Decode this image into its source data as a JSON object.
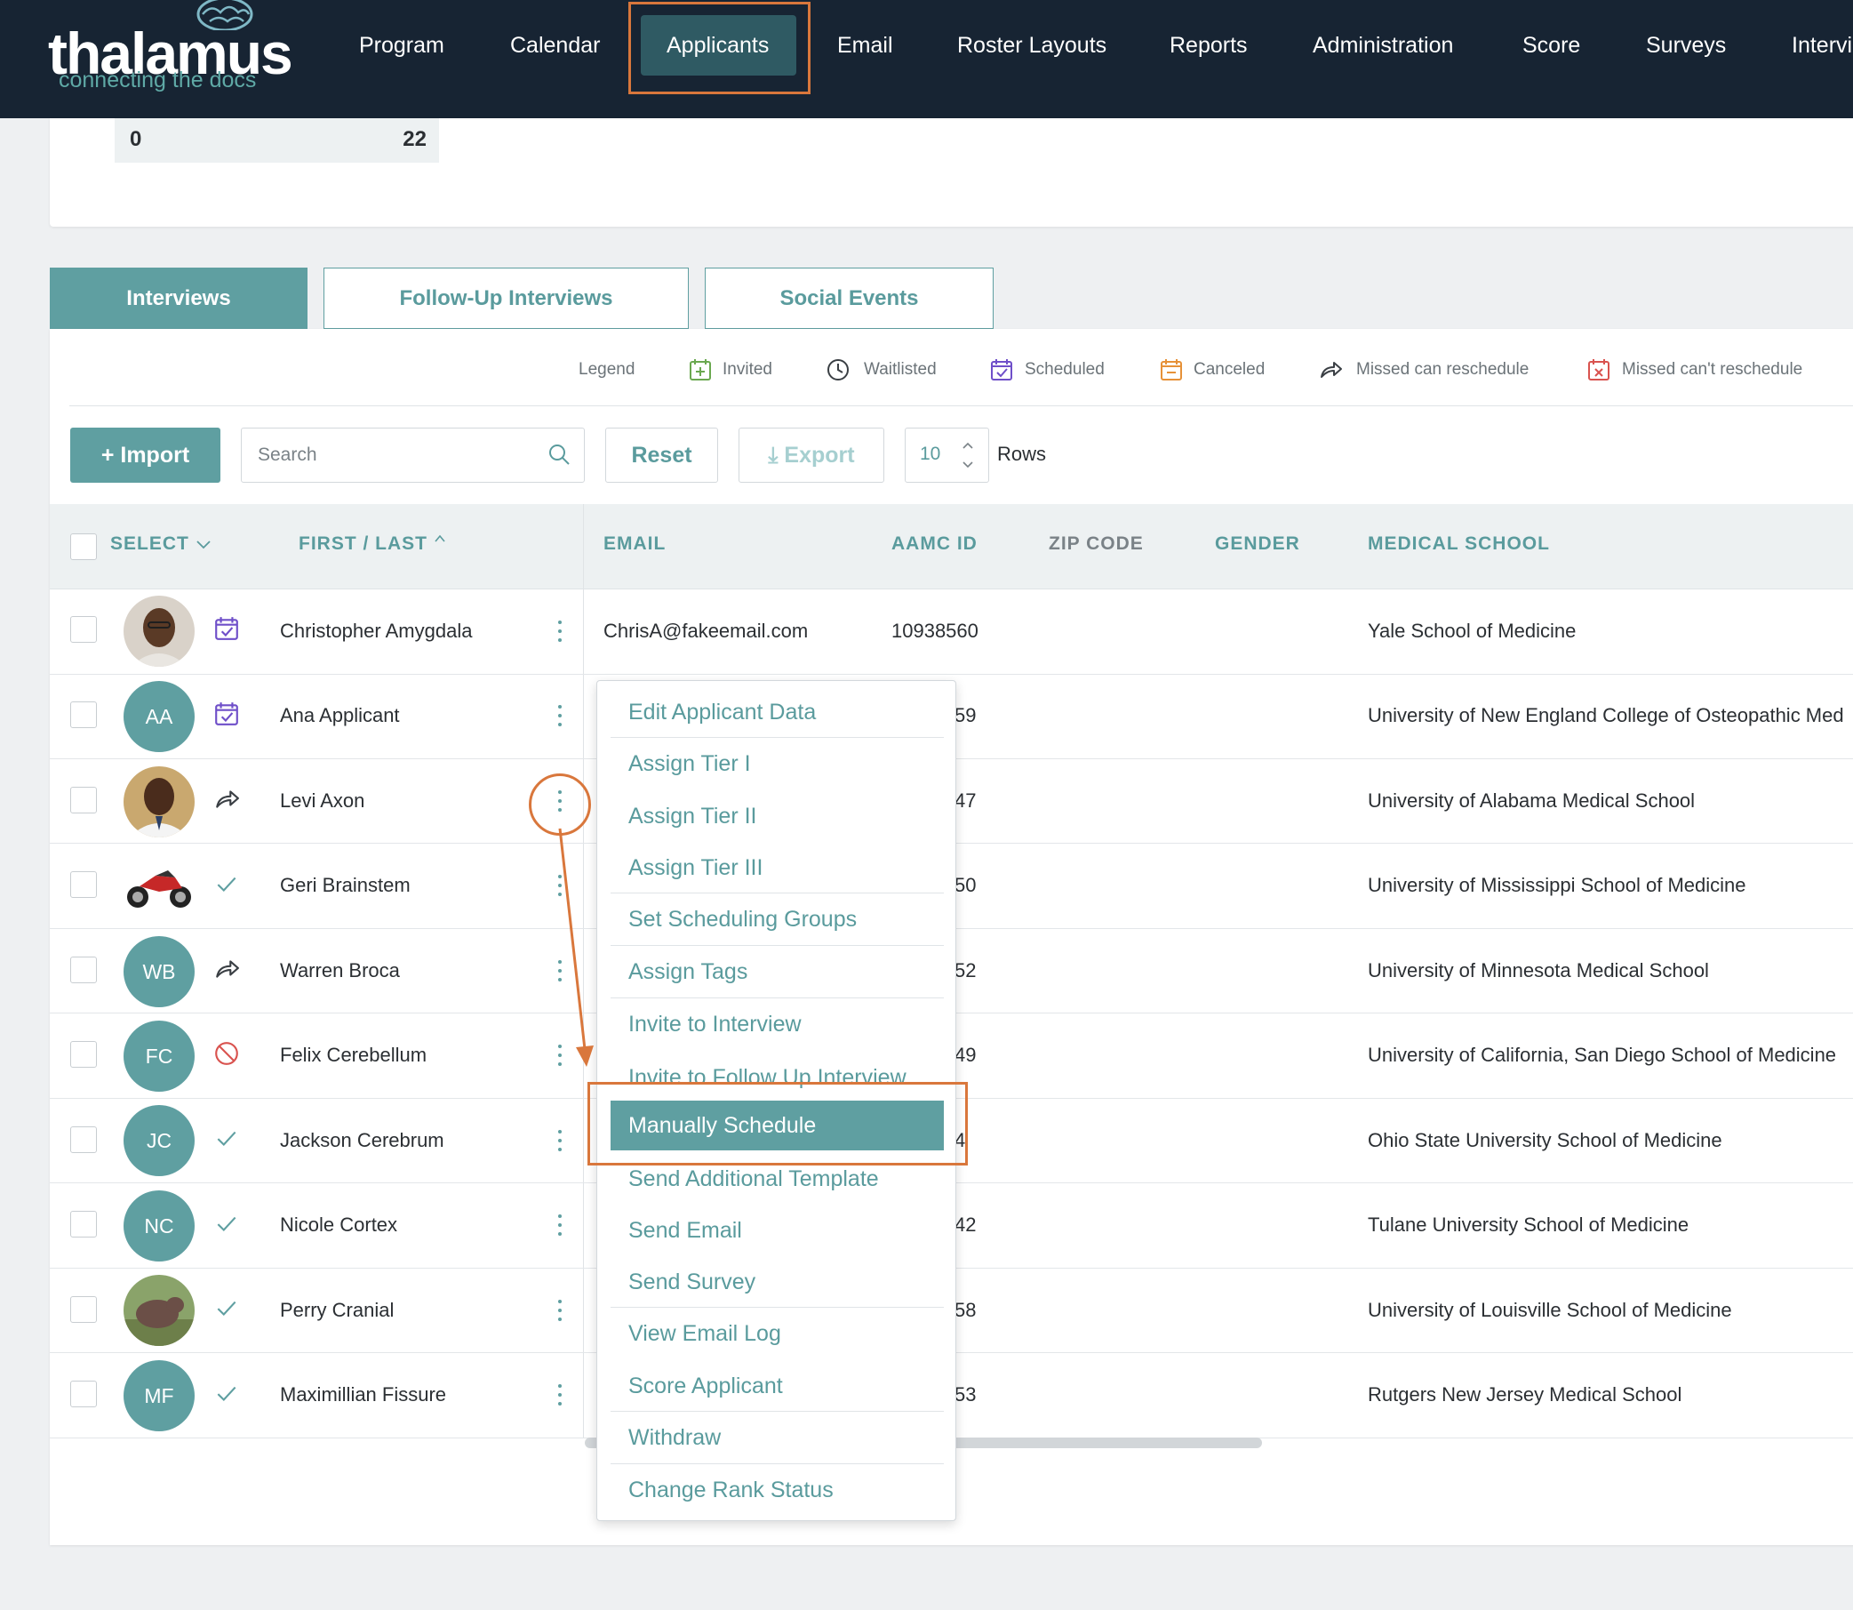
{
  "nav": {
    "logo_word": "thalamus",
    "logo_tagline": "connecting the docs",
    "items": [
      {
        "label": "Program"
      },
      {
        "label": "Calendar"
      },
      {
        "label": "Applicants",
        "active": true
      },
      {
        "label": "Email"
      },
      {
        "label": "Roster Layouts"
      },
      {
        "label": "Reports"
      },
      {
        "label": "Administration"
      },
      {
        "label": "Score"
      },
      {
        "label": "Surveys"
      },
      {
        "label": "Intervi"
      }
    ]
  },
  "summary": {
    "left_value": "0",
    "right_value": "22"
  },
  "tabs": [
    {
      "label": "Interviews",
      "active": true
    },
    {
      "label": "Follow-Up Interviews"
    },
    {
      "label": "Social Events"
    }
  ],
  "legend": {
    "title": "Legend",
    "items": [
      {
        "label": "Invited",
        "icon": "calendar-plus-icon",
        "color": "#6aa84f"
      },
      {
        "label": "Waitlisted",
        "icon": "clock-icon",
        "color": "#3a3f44"
      },
      {
        "label": "Scheduled",
        "icon": "calendar-check-icon",
        "color": "#6f4fc9"
      },
      {
        "label": "Canceled",
        "icon": "calendar-minus-icon",
        "color": "#e69138"
      },
      {
        "label": "Missed can reschedule",
        "icon": "share-arrow-icon",
        "color": "#3a3f44"
      },
      {
        "label": "Missed can't reschedule",
        "icon": "calendar-x-icon",
        "color": "#d9534f"
      }
    ]
  },
  "toolbar": {
    "import_label": "+ Import",
    "search_placeholder": "Search",
    "reset_label": "Reset",
    "export_label": "⤓ Export",
    "rows_value": "10",
    "rows_label": "Rows"
  },
  "table": {
    "headers": {
      "select": "SELECT",
      "name": "FIRST / LAST",
      "email": "EMAIL",
      "aamc": "AAMC ID",
      "zip": "ZIP CODE",
      "gender": "GENDER",
      "school": "MEDICAL SCHOOL"
    },
    "rows": [
      {
        "name": "Christopher Amygdala",
        "avatar": "photo",
        "status": "scheduled",
        "email": "ChrisA@fakeemail.com",
        "aamc": "10938560",
        "school": "Yale School of Medicine"
      },
      {
        "name": "Ana Applicant",
        "avatar": "AA",
        "status": "scheduled",
        "email": "",
        "aamc": "59",
        "school": "University of New England College of Osteopathic Med"
      },
      {
        "name": "Levi Axon",
        "avatar": "photo",
        "status": "missed-reschedule",
        "email": "",
        "aamc": "47",
        "school": "University of Alabama Medical School"
      },
      {
        "name": "Geri Brainstem",
        "avatar": "photo",
        "status": "check",
        "email": "",
        "aamc": "50",
        "school": "University of Mississippi School of Medicine"
      },
      {
        "name": "Warren Broca",
        "avatar": "WB",
        "status": "missed-reschedule",
        "email": "",
        "aamc": "52",
        "school": "University of Minnesota Medical School"
      },
      {
        "name": "Felix Cerebellum",
        "avatar": "FC",
        "status": "blocked",
        "email": "",
        "aamc": "49",
        "school": "University of California, San Diego School of Medicine"
      },
      {
        "name": "Jackson Cerebrum",
        "avatar": "JC",
        "status": "check",
        "email": "",
        "aamc": "4",
        "school": "Ohio State University School of Medicine"
      },
      {
        "name": "Nicole Cortex",
        "avatar": "NC",
        "status": "check",
        "email": "",
        "aamc": "42",
        "school": "Tulane University School of Medicine"
      },
      {
        "name": "Perry Cranial",
        "avatar": "photo",
        "status": "check",
        "email": "",
        "aamc": "58",
        "school": "University of Louisville School of Medicine"
      },
      {
        "name": "Maximillian Fissure",
        "avatar": "MF",
        "status": "check",
        "email": "",
        "aamc": "53",
        "school": "Rutgers New Jersey Medical School"
      }
    ]
  },
  "context_menu": {
    "items": [
      {
        "label": "Edit Applicant Data"
      },
      {
        "label": "Assign Tier I"
      },
      {
        "label": "Assign Tier II"
      },
      {
        "label": "Assign Tier III"
      },
      {
        "label": "Set Scheduling Groups"
      },
      {
        "label": "Assign Tags"
      },
      {
        "label": "Invite to Interview"
      },
      {
        "label": "Invite to Follow Up Interview"
      },
      {
        "label": "Manually Schedule",
        "active": true
      },
      {
        "label": "Send Additional Template"
      },
      {
        "label": "Send Email"
      },
      {
        "label": "Send Survey"
      },
      {
        "label": "View Email Log"
      },
      {
        "label": "Score Applicant"
      },
      {
        "label": "Withdraw"
      },
      {
        "label": "Change Rank Status"
      }
    ]
  },
  "colors": {
    "accent": "#5f9fa1",
    "nav_bg": "#172433",
    "highlight": "#d9773c"
  }
}
